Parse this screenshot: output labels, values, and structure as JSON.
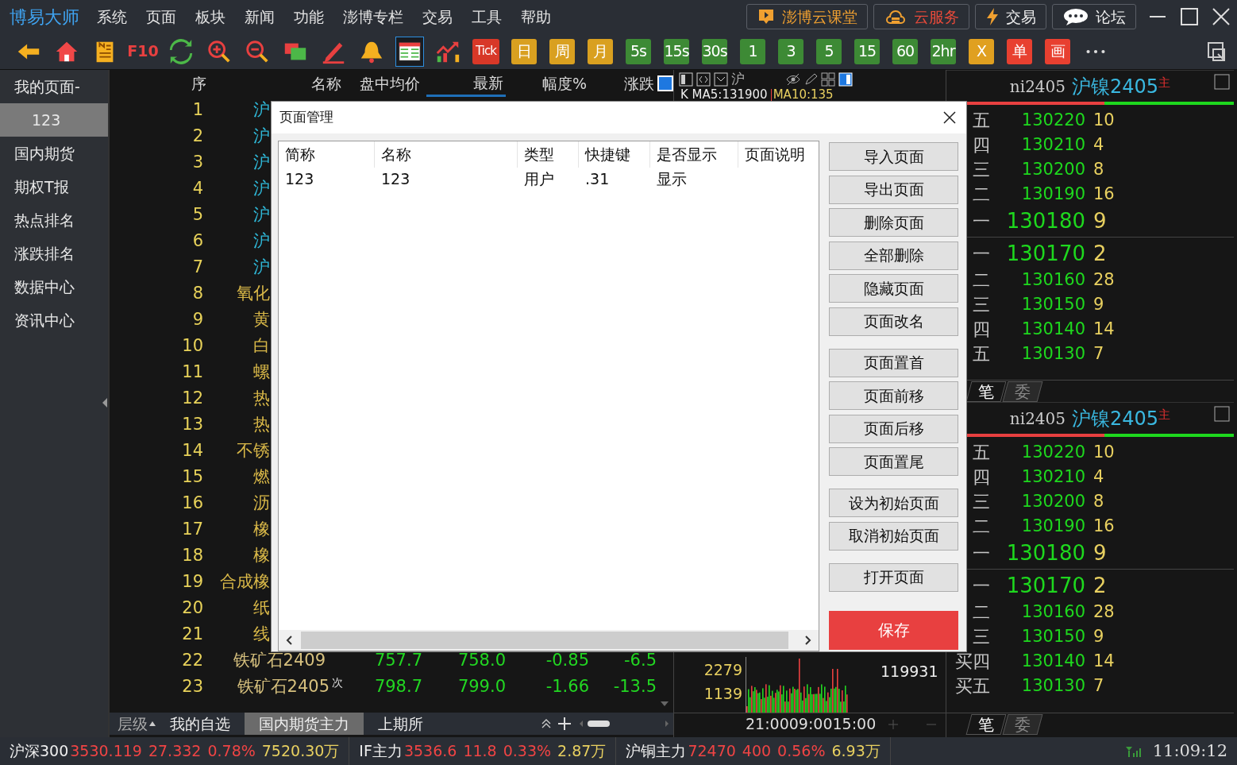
{
  "title_bar": {
    "logo": "博易大师",
    "menu": [
      "系统",
      "页面",
      "板块",
      "新闻",
      "功能",
      "澎博专栏",
      "交易",
      "工具",
      "帮助"
    ],
    "links": [
      {
        "kind": "video",
        "label": "澎博云课堂"
      },
      {
        "kind": "cloud",
        "label": "云服务"
      },
      {
        "kind": "bolt",
        "label": "交易"
      },
      {
        "kind": "chat",
        "label": "论坛"
      }
    ]
  },
  "toolbar": [
    {
      "kind": "back",
      "selected": false
    },
    {
      "kind": "home",
      "selected": false
    },
    {
      "kind": "note",
      "selected": false
    },
    {
      "kind": "redtext",
      "label": "F10",
      "selected": false
    },
    {
      "kind": "refresh",
      "selected": false
    },
    {
      "kind": "zoom-in",
      "selected": false
    },
    {
      "kind": "zoom-out",
      "selected": false
    },
    {
      "kind": "windows",
      "selected": false
    },
    {
      "kind": "pen",
      "selected": false
    },
    {
      "kind": "bell",
      "selected": false
    },
    {
      "kind": "grid",
      "selected": true
    },
    {
      "kind": "trend",
      "selected": false
    },
    {
      "kind": "tick",
      "label": "Tick",
      "selected": false
    },
    {
      "kind": "gold",
      "label": "日",
      "selected": false
    },
    {
      "kind": "gold",
      "label": "周",
      "selected": false
    },
    {
      "kind": "gold",
      "label": "月",
      "selected": false
    },
    {
      "kind": "green",
      "label": "5s",
      "selected": false
    },
    {
      "kind": "green",
      "label": "15s",
      "selected": false
    },
    {
      "kind": "green",
      "label": "30s",
      "selected": false
    },
    {
      "kind": "green",
      "label": "1",
      "selected": false
    },
    {
      "kind": "green",
      "label": "3",
      "selected": false
    },
    {
      "kind": "green",
      "label": "5",
      "selected": false
    },
    {
      "kind": "green",
      "label": "15",
      "selected": false
    },
    {
      "kind": "green",
      "label": "60",
      "selected": false
    },
    {
      "kind": "green",
      "label": "2hr",
      "selected": false
    },
    {
      "kind": "orange",
      "label": "X",
      "selected": false
    },
    {
      "kind": "red",
      "label": "单",
      "selected": false
    },
    {
      "kind": "red",
      "label": "画",
      "selected": false
    },
    {
      "kind": "more",
      "selected": false
    }
  ],
  "sidebar": {
    "title": "我的页面-",
    "items": [
      {
        "label": "123",
        "selected": true
      },
      {
        "label": "国内期货",
        "selected": false
      },
      {
        "label": "期权T报",
        "selected": false
      },
      {
        "label": "热点排名",
        "selected": false
      },
      {
        "label": "涨跌排名",
        "selected": false
      },
      {
        "label": "数据中心",
        "selected": false
      },
      {
        "label": "资讯中心",
        "selected": false
      }
    ]
  },
  "table": {
    "columns": [
      "序",
      "名称",
      "盘中均价",
      "最新",
      "幅度%",
      "涨跌"
    ],
    "rows": [
      {
        "no": "1",
        "name": "沪",
        "color": "#2fb8d8",
        "covered": true
      },
      {
        "no": "2",
        "name": "沪",
        "color": "#2fb8d8",
        "covered": true
      },
      {
        "no": "3",
        "name": "沪",
        "color": "#2fb8d8",
        "covered": true
      },
      {
        "no": "4",
        "name": "沪",
        "color": "#2fb8d8",
        "covered": true
      },
      {
        "no": "5",
        "name": "沪",
        "color": "#2fb8d8",
        "covered": true
      },
      {
        "no": "6",
        "name": "沪",
        "color": "#2fb8d8",
        "covered": true
      },
      {
        "no": "7",
        "name": "沪",
        "color": "#2fb8d8",
        "covered": true
      },
      {
        "no": "8",
        "name": "氧化",
        "color": "#d9b848",
        "covered": true
      },
      {
        "no": "9",
        "name": "黄",
        "color": "#d9b848",
        "covered": true
      },
      {
        "no": "10",
        "name": "白",
        "color": "#d9b848",
        "covered": true
      },
      {
        "no": "11",
        "name": "螺",
        "color": "#d9b848",
        "covered": true
      },
      {
        "no": "12",
        "name": "热",
        "color": "#d9b848",
        "covered": true
      },
      {
        "no": "13",
        "name": "热",
        "color": "#d9b848",
        "covered": true
      },
      {
        "no": "14",
        "name": "不锈",
        "color": "#d9b848",
        "covered": true
      },
      {
        "no": "15",
        "name": "燃",
        "color": "#d9b848",
        "covered": true
      },
      {
        "no": "16",
        "name": "沥",
        "color": "#d9b848",
        "covered": true
      },
      {
        "no": "17",
        "name": "橡",
        "color": "#d9b848",
        "covered": true
      },
      {
        "no": "18",
        "name": "橡",
        "color": "#d9b848",
        "covered": true
      },
      {
        "no": "19",
        "name": "合成橡",
        "color": "#d9b848",
        "covered": true
      },
      {
        "no": "20",
        "name": "纸",
        "color": "#d9b848",
        "covered": true
      },
      {
        "no": "21",
        "name": "线",
        "color": "#d9b848",
        "covered": true
      },
      {
        "no": "22",
        "name": "铁矿石2409",
        "color": "#d6c07e",
        "covered": false,
        "avg": "757.7",
        "last": "758.0",
        "pct": "-0.85",
        "change": "-6.5"
      },
      {
        "no": "23",
        "name": "铁矿石2405",
        "tag": "次",
        "color": "#d6c07e",
        "covered": false,
        "avg": "798.7",
        "last": "799.0",
        "pct": "-1.66",
        "change": "-13.5"
      }
    ]
  },
  "chart_header": {
    "symbol": "沪",
    "ma5": "K MA5:131900",
    "ma10": "MA10:135"
  },
  "volume_panel": {
    "ticks": [
      "2279",
      "1139"
    ],
    "value": "119931",
    "times": [
      "21:00",
      "09:00",
      "15:00"
    ]
  },
  "bottom_tabs": {
    "level": "层级",
    "tabs": [
      {
        "label": "我的自选",
        "selected": false
      },
      {
        "label": "国内期货主力",
        "selected": true
      },
      {
        "label": "上期所",
        "selected": false
      }
    ]
  },
  "order_books": [
    {
      "code": "ni2405",
      "name": "沪镍2405",
      "tag": "主",
      "level": 0.55,
      "asks": [
        {
          "label": "五",
          "price": "130220",
          "volume": "10",
          "kind": "normal"
        },
        {
          "label": "四",
          "price": "130210",
          "volume": "4",
          "kind": "normal"
        },
        {
          "label": "三",
          "price": "130200",
          "volume": "8",
          "kind": "normal"
        },
        {
          "label": "二",
          "price": "130190",
          "volume": "16",
          "kind": "normal"
        },
        {
          "label": "一",
          "price": "130180",
          "volume": "9",
          "kind": "best"
        }
      ],
      "bids": [
        {
          "label": "一",
          "price": "130170",
          "volume": "2",
          "kind": "best"
        },
        {
          "label": "二",
          "price": "130160",
          "volume": "28",
          "kind": "normal"
        },
        {
          "label": "三",
          "price": "130150",
          "volume": "9",
          "kind": "normal"
        },
        {
          "label": "四",
          "price": "130140",
          "volume": "14",
          "kind": "normal"
        },
        {
          "label": "五",
          "price": "130130",
          "volume": "7",
          "kind": "normal"
        }
      ],
      "tabs": [
        {
          "label": "笔",
          "selected": true
        },
        {
          "label": "委",
          "selected": false
        }
      ]
    },
    {
      "code": "ni2405",
      "name": "沪镍2405",
      "tag": "主",
      "level": 0.55,
      "asks": [
        {
          "label": "五",
          "price": "130220",
          "volume": "10",
          "kind": "normal"
        },
        {
          "label": "四",
          "price": "130210",
          "volume": "4",
          "kind": "normal"
        },
        {
          "label": "三",
          "price": "130200",
          "volume": "8",
          "kind": "normal"
        },
        {
          "label": "二",
          "price": "130190",
          "volume": "16",
          "kind": "normal"
        },
        {
          "label": "一",
          "price": "130180",
          "volume": "9",
          "kind": "best"
        }
      ],
      "bids": [
        {
          "label": "一",
          "price": "130170",
          "volume": "2",
          "kind": "best"
        },
        {
          "label": "二",
          "price": "130160",
          "volume": "28",
          "kind": "normal"
        },
        {
          "label": "三",
          "price": "130150",
          "volume": "9",
          "kind": "normal"
        },
        {
          "label": "买四",
          "price": "130140",
          "volume": "14",
          "kind": "normal"
        },
        {
          "label": "买五",
          "price": "130130",
          "volume": "7",
          "kind": "normal"
        }
      ],
      "tabs": [
        {
          "label": "笔",
          "selected": true
        },
        {
          "label": "委",
          "selected": false
        }
      ]
    }
  ],
  "status_bar": {
    "quotes": [
      {
        "name": "沪深300",
        "price": "3530.119",
        "change": "27.332",
        "pct": "0.78%",
        "volume": "7520.30万"
      },
      {
        "name": "IF主力",
        "price": "3536.6",
        "change": "11.8",
        "pct": "0.33%",
        "volume": "2.87万"
      },
      {
        "name": "沪铜主力",
        "price": "72470",
        "change": "400",
        "pct": "0.56%",
        "volume": "6.93万"
      }
    ],
    "time": "11:09:12"
  },
  "dialog": {
    "title": "页面管理",
    "columns": [
      "简称",
      "名称",
      "类型",
      "快捷键",
      "是否显示",
      "页面说明"
    ],
    "rows": [
      [
        "123",
        "123",
        "用户",
        ".31",
        "显示"
      ]
    ],
    "button_groups": [
      [
        "导入页面",
        "导出页面",
        "删除页面",
        "全部删除",
        "隐藏页面",
        "页面改名"
      ],
      [
        "页面置首",
        "页面前移",
        "页面后移",
        "页面置尾"
      ],
      [
        "设为初始页面",
        "取消初始页面"
      ],
      [
        "打开页面"
      ]
    ],
    "save": "保存"
  }
}
